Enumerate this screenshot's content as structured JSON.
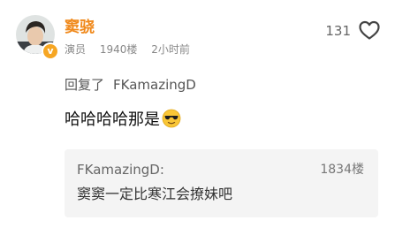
{
  "comment": {
    "author": {
      "name": "窦骁",
      "role": "演员",
      "avatar_icon": "user-avatar-photo",
      "verified_icon": "verified-v-badge-icon",
      "verified_mark": "v",
      "verified_color": "#f6a623",
      "name_color": "#f0891b"
    },
    "floor": "1940楼",
    "time": "2小时前",
    "likes": {
      "count": "131",
      "icon": "heart-outline-icon"
    },
    "reply": {
      "prefix": "回复了",
      "target": "FKamazingD"
    },
    "text": "哈哈哈哈那是",
    "emoji_icon": "cool-sunglasses-emoji-icon",
    "quoted": {
      "author": "FKamazingD:",
      "floor": "1834楼",
      "text": "窦窦一定比寒江会撩妹吧"
    }
  }
}
